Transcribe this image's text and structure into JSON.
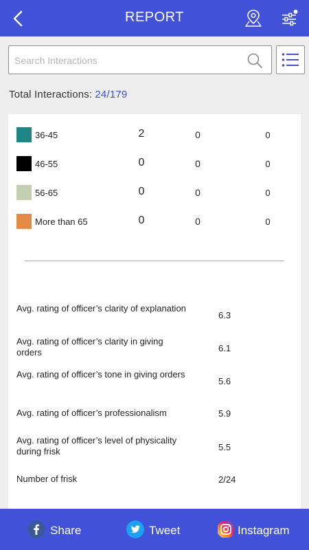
{
  "header": {
    "title": "REPORT"
  },
  "search": {
    "placeholder": "Search Interactions"
  },
  "summary": {
    "label": "Total Interactions:",
    "value": "24/179"
  },
  "age_groups": [
    {
      "label": "36-45",
      "color": "#1f8585",
      "col1": "2",
      "col2": "0",
      "col3": "0"
    },
    {
      "label": "46-55",
      "color": "#000000",
      "col1": "0",
      "col2": "0",
      "col3": "0"
    },
    {
      "label": "56-65",
      "color": "#c3cfae",
      "col1": "0",
      "col2": "0",
      "col3": "0"
    },
    {
      "label": "More than 65",
      "color": "#e48a47",
      "col1": "0",
      "col2": "0",
      "col3": "0"
    }
  ],
  "ratings": [
    {
      "label": "Avg. rating of officer’s clarity of explanation",
      "value": "6.3"
    },
    {
      "label": "Avg. rating of officer’s clarity in giving orders",
      "value": "6.1"
    },
    {
      "label": "Avg. rating of officer’s tone in giving orders",
      "value": "5.6"
    },
    {
      "label": "Avg. rating of officer’s professionalism",
      "value": "5.9"
    },
    {
      "label": "Avg. rating of officer’s level of physicality during frisk",
      "value": "5.5"
    },
    {
      "label": "Number of frisk",
      "value": "2/24"
    }
  ],
  "footer": {
    "share_label": "Share",
    "tweet_label": "Tweet",
    "instagram_label": "Instagram"
  },
  "colors": {
    "accent": "#4152d8",
    "value_blue": "#3c50d2"
  }
}
